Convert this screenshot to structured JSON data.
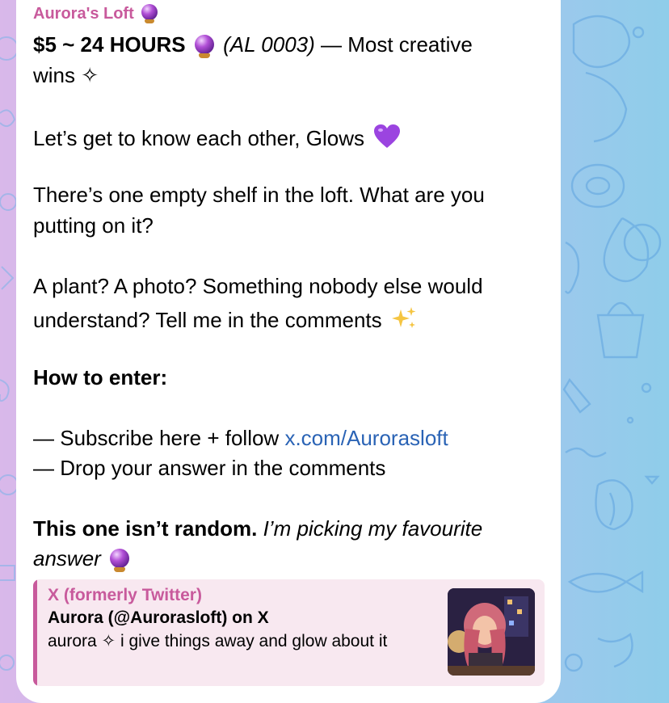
{
  "channel": {
    "name": "Aurora's Loft"
  },
  "message": {
    "title_bold": "$5 ~ 24 HOURS",
    "title_italic": "(AL 0003)",
    "title_rest": "— Most creative",
    "title_line2": "wins ✧",
    "p1": "Let’s get to know each other, Glows",
    "p2_line1": "There’s one empty shelf in the loft. What are you",
    "p2_line2": "putting on it?",
    "p3_line1": "A plant? A photo? Something nobody else would",
    "p3_line2": "understand? Tell me in the comments",
    "how_heading": "How to enter:",
    "step1_prefix": "— Subscribe here + follow ",
    "step1_link": "x.com/Aurorasloft",
    "step2": "— Drop your answer in the comments",
    "closing_bold": "This one isn’t random.",
    "closing_italic": " I’m picking my favourite",
    "closing_line2": "answer"
  },
  "link_preview": {
    "site": "X (formerly Twitter)",
    "title": "Aurora (@Aurorasloft) on X",
    "description": "aurora ✧ i give things away and glow about it"
  },
  "colors": {
    "accent": "#c85a9c",
    "link": "#2a63b5",
    "preview_background": "#f8e8f0",
    "bubble": "#ffffff"
  },
  "icons": [
    "crystal-ball-icon",
    "purple-heart-icon",
    "sparkles-icon"
  ]
}
